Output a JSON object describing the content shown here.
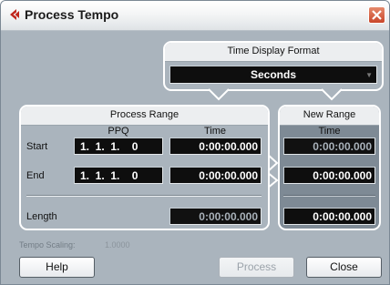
{
  "window": {
    "title": "Process Tempo"
  },
  "time_display": {
    "header": "Time Display Format",
    "selected": "Seconds"
  },
  "process_range": {
    "header": "Process Range",
    "col_ppq": "PPQ",
    "col_time": "Time",
    "start_label": "Start",
    "end_label": "End",
    "length_label": "Length",
    "start_ppq": "1.  1.  1.    0",
    "start_time": "0:00:00.000",
    "end_ppq": "1.  1.  1.    0",
    "end_time": "0:00:00.000",
    "length_time": "0:00:00.000"
  },
  "new_range": {
    "header": "New Range",
    "col_time": "Time",
    "start_time": "0:00:00.000",
    "end_time": "0:00:00.000",
    "length_time": "0:00:00.000"
  },
  "tempo_scaling": {
    "label": "Tempo Scaling:",
    "value": "1.0000"
  },
  "buttons": {
    "help": "Help",
    "process": "Process",
    "close": "Close"
  },
  "colors": {
    "titlebar_close": "#c9462a",
    "app_icon": "#c0261c",
    "panel_bg": "#aab4bd",
    "new_range_bg": "#7e8a95"
  }
}
